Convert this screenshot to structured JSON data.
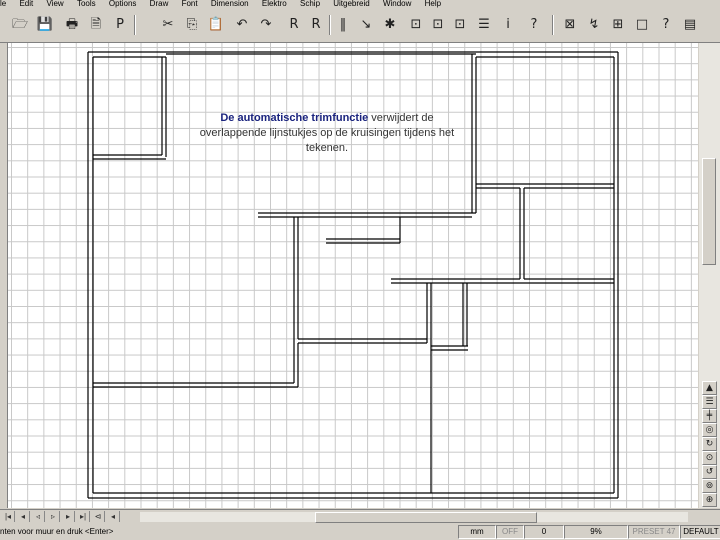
{
  "menu": [
    "le",
    "Edit",
    "View",
    "Tools",
    "Options",
    "Draw",
    "Font",
    "Dimension",
    "Elektro",
    "Schip",
    "Uitgebreid",
    "Window",
    "Help"
  ],
  "toolbar": {
    "icons": [
      "open-folder-icon",
      "save-icon",
      "print-icon",
      "print-preview-icon",
      "page-setup-icon",
      "cut-icon",
      "copy-icon",
      "paste-icon",
      "undo-icon",
      "redo-icon",
      "draw-icon",
      "object-properties-icon",
      "vertical-line-icon",
      "node-edit-icon",
      "add-node-icon",
      "selection-handles-icon",
      "table-icon",
      "info-icon",
      "help-pointer-icon",
      "zoom-window-icon",
      "constraint-icon",
      "tile-icon",
      "square-icon",
      "question-icon",
      "document-icon"
    ],
    "glyphs": [
      "🗁",
      "💾",
      "🖶",
      "🗎",
      "P",
      "✂",
      "⎘",
      "📋",
      "↶",
      "↷",
      "R",
      "R",
      "‖",
      "↘",
      "✱",
      "⊡",
      "☰",
      "i",
      "?",
      "⊠",
      "↯",
      "⊞",
      "□",
      "?",
      "▤"
    ]
  },
  "caption": {
    "bold": "De automatische trimfunctie",
    "rest": " verwijdert de overlappende lijnstukjes op de kruisingen tijdens het tekenen."
  },
  "right_tools": [
    "▲",
    "☰",
    "╪",
    "◎",
    "↻",
    "⊙",
    "↺",
    "⊚",
    "⊕",
    "◉",
    "▼"
  ],
  "nav_buttons": [
    "|◂",
    "◂",
    "◃",
    "▹",
    "▸",
    "▸|",
    "⊲",
    "◂"
  ],
  "status": {
    "message": "nten voor muur en druk <Enter>",
    "unit": "mm",
    "snap": "OFF",
    "angle": "0",
    "zoom": "9%",
    "preset": "PRESET 47",
    "layer": "DEFAULT"
  },
  "colors": {
    "caption_bold": "#1a237e",
    "grid": "#c8c8c8",
    "chrome": "#d4d0c8"
  }
}
